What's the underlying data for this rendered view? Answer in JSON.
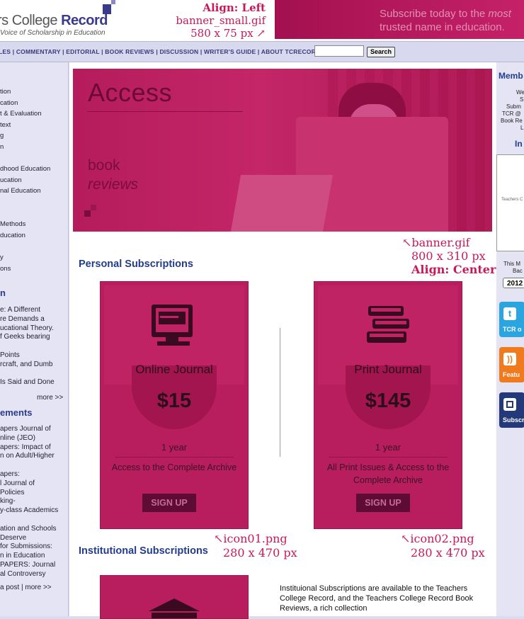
{
  "header": {
    "logo_main": "rs College ",
    "logo_bold": "Record",
    "logo_sub": "Voice of Scholarship in Education",
    "annotation_line1": "Align: Left",
    "annotation_line2": "banner_small.gif",
    "annotation_line3": "580 x 75 px ↗",
    "banner_line1": "Subscribe today to the",
    "banner_line1_em": " most",
    "banner_line2": "trusted name in education."
  },
  "nav": {
    "links": "LES  |  COMMENTARY  |  EDITORIAL  |  BOOK REVIEWS  |  DISCUSSION  |  WRITER'S GUIDE  |  ABOUT TCRECORD",
    "search_value": "",
    "search_button": "Search"
  },
  "left_sidebar": {
    "topics": [
      "tion",
      "cation",
      "t & Evaluation",
      "text",
      "g",
      "n",
      "",
      "dhood Education",
      "ucation",
      "nal Education",
      "",
      "",
      "Methods",
      "ducation",
      "",
      "y",
      "ons"
    ],
    "heading1": "n",
    "articles": [
      "e: A Different",
      "re Demands a",
      "ucational Theory.",
      "f Geeks bearing",
      "",
      "Points",
      "rcraft, and Dumb",
      "",
      "Is Said and Done"
    ],
    "more1": "more >>",
    "heading2": "ements",
    "announcements": [
      "apers Journal of",
      "nline (JEO)",
      "apers: Impact of",
      "n on Adult/Higher",
      "",
      "apers:",
      "l Journal of",
      "Policies",
      "king-",
      "y-class Academics",
      "",
      "ation and Schools",
      " Deserve",
      "for Submissions:",
      "n in Education",
      " PAPERS: Journal",
      "al Controversy"
    ],
    "more2": " a post | more >>"
  },
  "hero": {
    "title": "Access",
    "sub1": "book",
    "sub2": "reviews",
    "ann1": "↖banner.gif",
    "ann2": "800 x 310 px",
    "ann3": "Align: Center"
  },
  "personal": {
    "heading": "Personal Subscriptions",
    "cards": [
      {
        "title": "Online Journal",
        "price": "$15",
        "term": "1 year",
        "desc": "Access to the Complete Archive",
        "button": "SIGN UP",
        "ann1": "↖icon01.png",
        "ann2": "280 x 470 px"
      },
      {
        "title": "Print Journal",
        "price": "$145",
        "term": "1 year",
        "desc": "All Print Issues & Access to the Complete Archive",
        "button": "SIGN UP",
        "ann1": "↖icon02.png",
        "ann2": "280 x 470 px"
      }
    ]
  },
  "institutional": {
    "heading": "Institutional Subscriptions",
    "text": "Instituional Subscriptions are available to the Teachers College Record, and the Teachers College Record Book Reviews, a rich collection"
  },
  "right_sidebar": {
    "heading": "Memb",
    "items": [
      "We",
      "S",
      "Subm",
      "TCR @",
      "Book Re",
      "L"
    ],
    "heading2": "In",
    "cover_text": "Teachers C",
    "month_label1": "This M",
    "month_label2": "Bac",
    "year": "2012",
    "twitter": "TCR o",
    "rss": "Featu",
    "subscribe": "Subscr"
  }
}
